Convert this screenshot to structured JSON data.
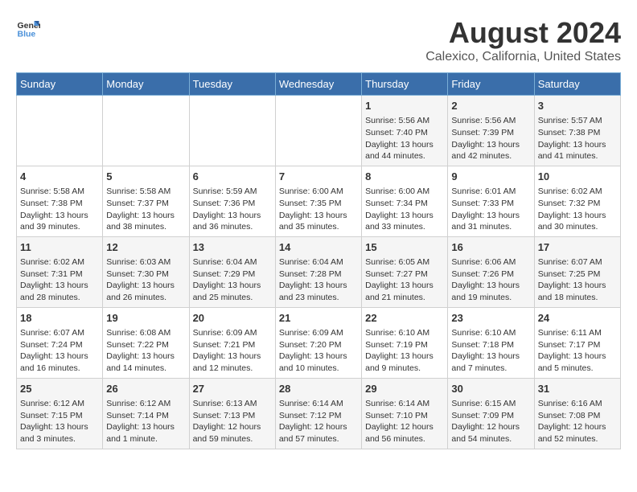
{
  "header": {
    "logo_general": "General",
    "logo_blue": "Blue",
    "title": "August 2024",
    "subtitle": "Calexico, California, United States"
  },
  "weekdays": [
    "Sunday",
    "Monday",
    "Tuesday",
    "Wednesday",
    "Thursday",
    "Friday",
    "Saturday"
  ],
  "weeks": [
    [
      {
        "day": "",
        "content": ""
      },
      {
        "day": "",
        "content": ""
      },
      {
        "day": "",
        "content": ""
      },
      {
        "day": "",
        "content": ""
      },
      {
        "day": "1",
        "content": "Sunrise: 5:56 AM\nSunset: 7:40 PM\nDaylight: 13 hours\nand 44 minutes."
      },
      {
        "day": "2",
        "content": "Sunrise: 5:56 AM\nSunset: 7:39 PM\nDaylight: 13 hours\nand 42 minutes."
      },
      {
        "day": "3",
        "content": "Sunrise: 5:57 AM\nSunset: 7:38 PM\nDaylight: 13 hours\nand 41 minutes."
      }
    ],
    [
      {
        "day": "4",
        "content": "Sunrise: 5:58 AM\nSunset: 7:38 PM\nDaylight: 13 hours\nand 39 minutes."
      },
      {
        "day": "5",
        "content": "Sunrise: 5:58 AM\nSunset: 7:37 PM\nDaylight: 13 hours\nand 38 minutes."
      },
      {
        "day": "6",
        "content": "Sunrise: 5:59 AM\nSunset: 7:36 PM\nDaylight: 13 hours\nand 36 minutes."
      },
      {
        "day": "7",
        "content": "Sunrise: 6:00 AM\nSunset: 7:35 PM\nDaylight: 13 hours\nand 35 minutes."
      },
      {
        "day": "8",
        "content": "Sunrise: 6:00 AM\nSunset: 7:34 PM\nDaylight: 13 hours\nand 33 minutes."
      },
      {
        "day": "9",
        "content": "Sunrise: 6:01 AM\nSunset: 7:33 PM\nDaylight: 13 hours\nand 31 minutes."
      },
      {
        "day": "10",
        "content": "Sunrise: 6:02 AM\nSunset: 7:32 PM\nDaylight: 13 hours\nand 30 minutes."
      }
    ],
    [
      {
        "day": "11",
        "content": "Sunrise: 6:02 AM\nSunset: 7:31 PM\nDaylight: 13 hours\nand 28 minutes."
      },
      {
        "day": "12",
        "content": "Sunrise: 6:03 AM\nSunset: 7:30 PM\nDaylight: 13 hours\nand 26 minutes."
      },
      {
        "day": "13",
        "content": "Sunrise: 6:04 AM\nSunset: 7:29 PM\nDaylight: 13 hours\nand 25 minutes."
      },
      {
        "day": "14",
        "content": "Sunrise: 6:04 AM\nSunset: 7:28 PM\nDaylight: 13 hours\nand 23 minutes."
      },
      {
        "day": "15",
        "content": "Sunrise: 6:05 AM\nSunset: 7:27 PM\nDaylight: 13 hours\nand 21 minutes."
      },
      {
        "day": "16",
        "content": "Sunrise: 6:06 AM\nSunset: 7:26 PM\nDaylight: 13 hours\nand 19 minutes."
      },
      {
        "day": "17",
        "content": "Sunrise: 6:07 AM\nSunset: 7:25 PM\nDaylight: 13 hours\nand 18 minutes."
      }
    ],
    [
      {
        "day": "18",
        "content": "Sunrise: 6:07 AM\nSunset: 7:24 PM\nDaylight: 13 hours\nand 16 minutes."
      },
      {
        "day": "19",
        "content": "Sunrise: 6:08 AM\nSunset: 7:22 PM\nDaylight: 13 hours\nand 14 minutes."
      },
      {
        "day": "20",
        "content": "Sunrise: 6:09 AM\nSunset: 7:21 PM\nDaylight: 13 hours\nand 12 minutes."
      },
      {
        "day": "21",
        "content": "Sunrise: 6:09 AM\nSunset: 7:20 PM\nDaylight: 13 hours\nand 10 minutes."
      },
      {
        "day": "22",
        "content": "Sunrise: 6:10 AM\nSunset: 7:19 PM\nDaylight: 13 hours\nand 9 minutes."
      },
      {
        "day": "23",
        "content": "Sunrise: 6:10 AM\nSunset: 7:18 PM\nDaylight: 13 hours\nand 7 minutes."
      },
      {
        "day": "24",
        "content": "Sunrise: 6:11 AM\nSunset: 7:17 PM\nDaylight: 13 hours\nand 5 minutes."
      }
    ],
    [
      {
        "day": "25",
        "content": "Sunrise: 6:12 AM\nSunset: 7:15 PM\nDaylight: 13 hours\nand 3 minutes."
      },
      {
        "day": "26",
        "content": "Sunrise: 6:12 AM\nSunset: 7:14 PM\nDaylight: 13 hours\nand 1 minute."
      },
      {
        "day": "27",
        "content": "Sunrise: 6:13 AM\nSunset: 7:13 PM\nDaylight: 12 hours\nand 59 minutes."
      },
      {
        "day": "28",
        "content": "Sunrise: 6:14 AM\nSunset: 7:12 PM\nDaylight: 12 hours\nand 57 minutes."
      },
      {
        "day": "29",
        "content": "Sunrise: 6:14 AM\nSunset: 7:10 PM\nDaylight: 12 hours\nand 56 minutes."
      },
      {
        "day": "30",
        "content": "Sunrise: 6:15 AM\nSunset: 7:09 PM\nDaylight: 12 hours\nand 54 minutes."
      },
      {
        "day": "31",
        "content": "Sunrise: 6:16 AM\nSunset: 7:08 PM\nDaylight: 12 hours\nand 52 minutes."
      }
    ]
  ]
}
